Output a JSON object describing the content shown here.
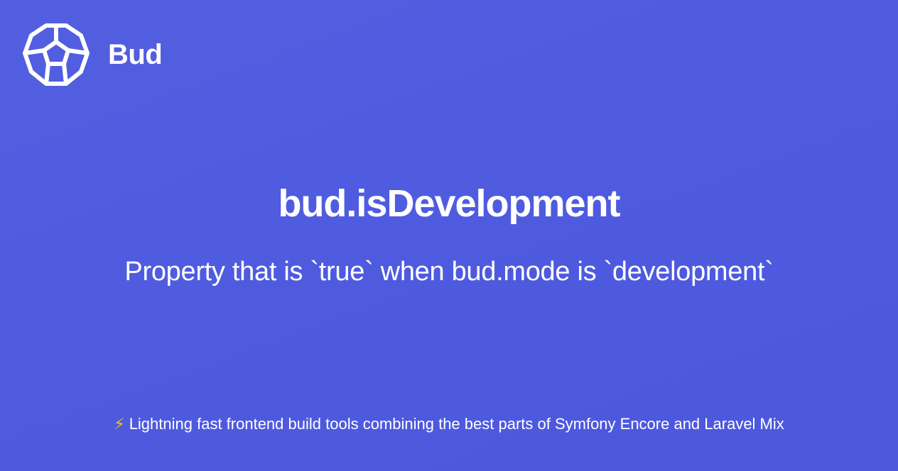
{
  "brand": {
    "name": "Bud",
    "logo_icon": "hexagon-cell-logo-icon"
  },
  "title": "bud.isDevelopment",
  "subtitle": "Property that is `true` when bud.mode is `development`",
  "tagline": {
    "icon": "lightning-bolt-icon",
    "bolt_glyph": "⚡",
    "text": "Lightning fast frontend build tools combining the best parts of Symfony Encore and Laravel Mix"
  },
  "colors": {
    "background": "#5060df",
    "text": "#ffffff",
    "bolt": "#f5c518"
  }
}
